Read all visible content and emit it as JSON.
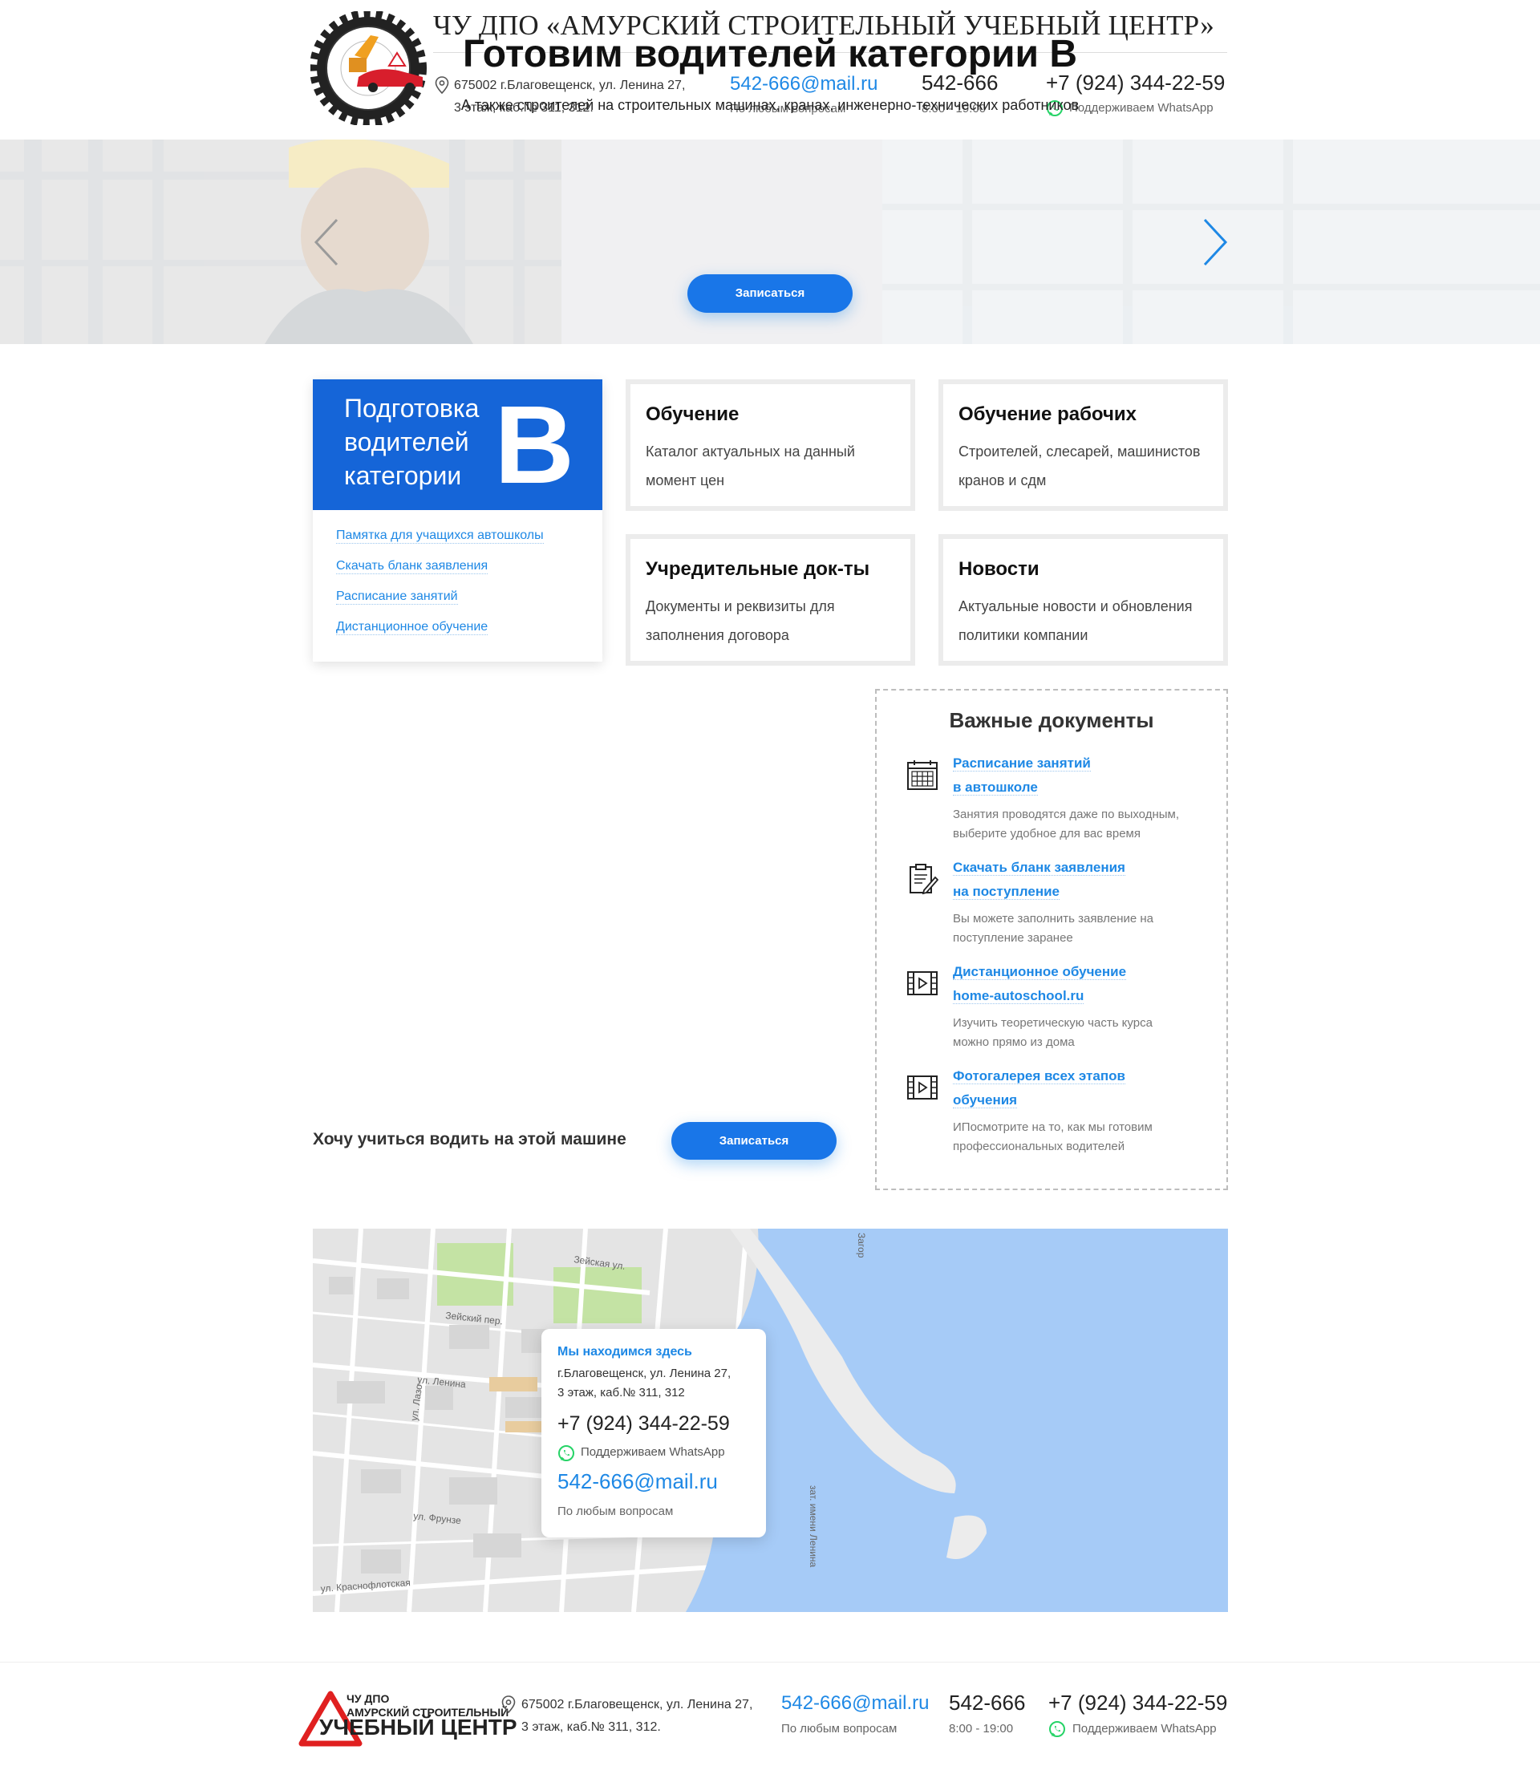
{
  "header": {
    "title": "ЧУ ДПО «АМУРСКИЙ СТРОИТЕЛЬНЫЙ УЧЕБНЫЙ ЦЕНТР»",
    "address_line1": "675002 г.Благовещенск, ул. Ленина 27,",
    "address_line2": "3 этаж, каб.№ 311, 312.",
    "email": "542-666@mail.ru",
    "email_sub": "По любым вопросам",
    "phone_short": "542-666",
    "hours": "8:00 - 19:00",
    "phone_full": "+7 (924) 344-22-59",
    "whatsapp_text": "Поддерживаем WhatsApp"
  },
  "hero": {
    "title": "Готовим водителей категории B",
    "subtitle": "А также строителей на строительных машинах, кранах,  инженерно-технических работников",
    "button": "Записаться"
  },
  "category_card": {
    "head_line1": "Подготовка",
    "head_line2": "водителей",
    "head_line3": "категории",
    "letter": "B",
    "links": [
      "Памятка для учащихся автошколы",
      "Скачать бланк заявления",
      "Расписание занятий",
      "Дистанционное обучение"
    ]
  },
  "services": [
    {
      "title": "Обучение",
      "desc": "Каталог актуальных на данный момент цен"
    },
    {
      "title": "Обучение рабочих",
      "desc": "Строителей, слесарей, машинистов кранов и сдм"
    },
    {
      "title": "Учредительные док-ты",
      "desc": "Документы и реквизиты для заполнения договора"
    },
    {
      "title": "Новости",
      "desc": "Актуальные новости и обновления политики компании"
    }
  ],
  "docs": {
    "title": "Важные документы",
    "items": [
      {
        "icon": "calendar-icon",
        "link1": "Расписание занятий",
        "link2": "в автошколе",
        "desc1": "Занятия проводятся даже по выходным,",
        "desc2": "выберите удобное для вас время"
      },
      {
        "icon": "clipboard-pen-icon",
        "link1": "Скачать бланк заявления",
        "link2": "на поступление",
        "desc1": "Вы можете заполнить заявление на",
        "desc2": "поступление заранее"
      },
      {
        "icon": "video-film-icon",
        "link1": "Дистанционное обучение",
        "link2": "home-autoschool.ru",
        "desc1": "Изучить теоретическую часть курса",
        "desc2": "можно прямо из дома"
      },
      {
        "icon": "video-film-icon",
        "link1": "Фотогалерея всех этапов",
        "link2": "обучения",
        "desc1": "ИПосмотрите на то, как мы готовим",
        "desc2": "профессиональных водителей"
      }
    ]
  },
  "want": {
    "text": "Хочу учиться водить на этой машине",
    "button": "Записаться"
  },
  "map": {
    "card_title": "Мы находимся здесь",
    "addr_line1": "г.Благовещенск, ул. Ленина 27,",
    "addr_line2": "3 этаж, каб.№ 311, 312",
    "phone": "+7 (924) 344-22-59",
    "whatsapp_text": "Поддерживаем WhatsApp",
    "email": "542-666@mail.ru",
    "email_sub": "По любым вопросам",
    "streets": [
      "Зейская ул.",
      "Зейский пер.",
      "ул. Ленина",
      "ул. Лазо",
      "ул. Фрунзе",
      "ул. Краснофлотская",
      "зат. имени Ленина",
      "Загор"
    ]
  },
  "footer": {
    "logo_line1": "ЧУ ДПО",
    "logo_line2": "АМУРСКИЙ СТРОИТЕЛЬНЫЙ",
    "logo_big": "УЧЕБНЫЙ ЦЕНТР",
    "address_line1": "675002 г.Благовещенск, ул. Ленина 27,",
    "address_line2": "3 этаж, каб.№ 311, 312.",
    "email": "542-666@mail.ru",
    "email_sub": "По любым вопросам",
    "phone_short": "542-666",
    "hours": "8:00 - 19:00",
    "phone_full": "+7 (924) 344-22-59",
    "whatsapp_text": "Поддерживаем WhatsApp"
  },
  "colors": {
    "accent": "#1976e8",
    "link": "#1e88e5",
    "category_head": "#1565d8",
    "water": "#a6cbf7",
    "whatsapp": "#25d366"
  }
}
